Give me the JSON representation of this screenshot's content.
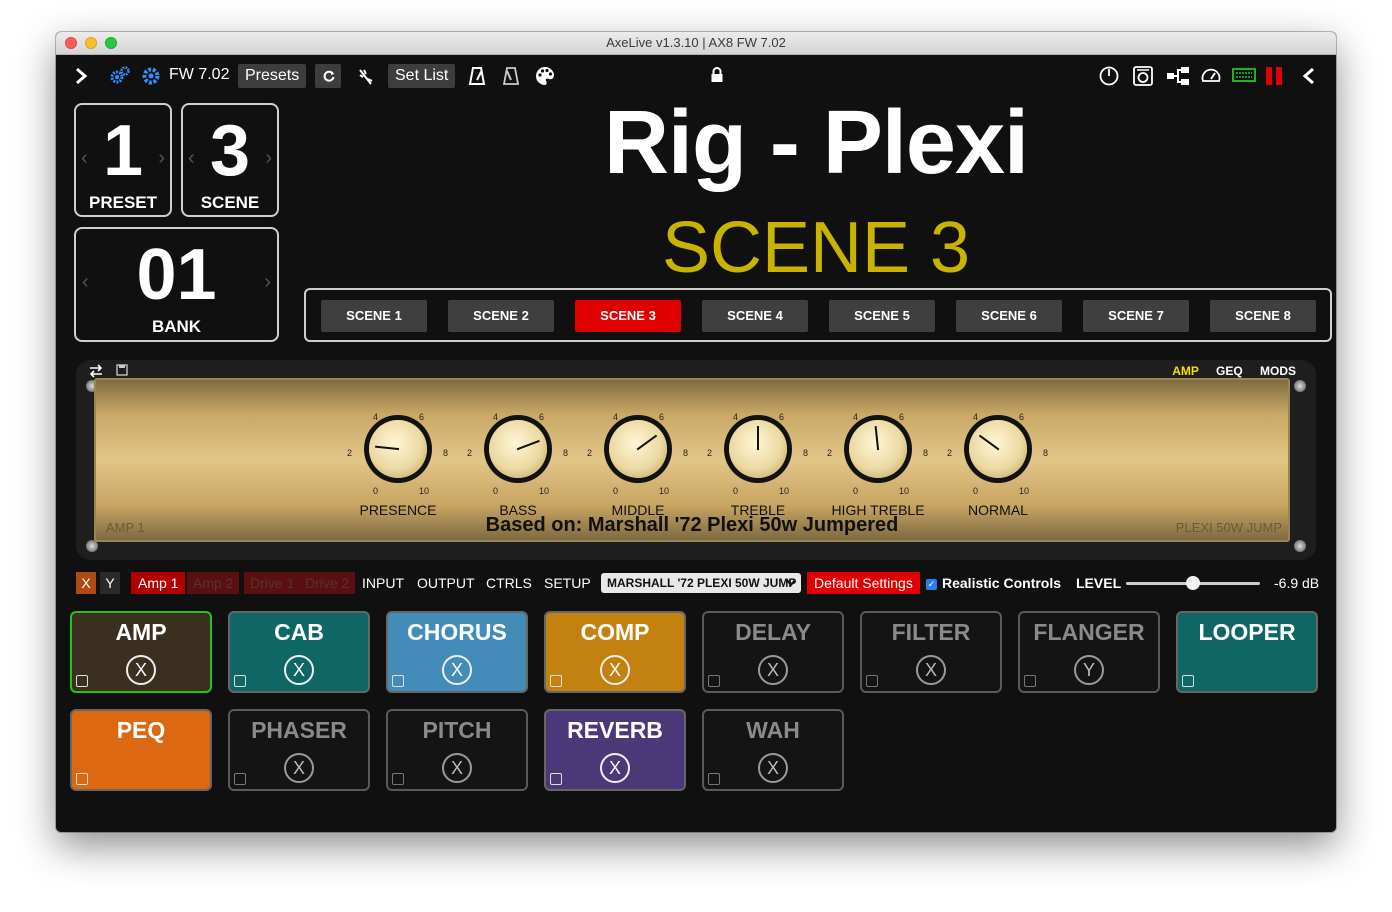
{
  "window": {
    "title": "AxeLive v1.3.10 | AX8 FW 7.02"
  },
  "toolbar": {
    "fw_label": "FW 7.02",
    "presets_label": "Presets",
    "setlist_label": "Set List",
    "icons_left": [
      "chevron-right-icon",
      "gears-icon",
      "gear-icon",
      "refresh-icon",
      "tuner-icon",
      "metronome-icon",
      "metronome-alt-icon",
      "palette-icon",
      "lock-icon"
    ],
    "icons_right": [
      "power-icon",
      "cabinet-icon",
      "routing-icon",
      "gauge-icon",
      "keyboard-icon",
      "pause-icon",
      "chevron-left-icon"
    ],
    "accent_green": "#21c421",
    "accent_red": "#e00000"
  },
  "preset": {
    "value": "1",
    "label": "PRESET"
  },
  "scene_counter": {
    "value": "3",
    "label": "SCENE"
  },
  "bank": {
    "value": "01",
    "label": "BANK"
  },
  "rig": {
    "name": "Rig - Plexi",
    "scene_name": "SCENE 3",
    "scene_color": "#c7b300"
  },
  "scenes": [
    "SCENE 1",
    "SCENE 2",
    "SCENE 3",
    "SCENE 4",
    "SCENE 5",
    "SCENE 6",
    "SCENE 7",
    "SCENE 8"
  ],
  "active_scene_index": 2,
  "amp": {
    "tabs": [
      "AMP",
      "GEQ",
      "MODS"
    ],
    "active_tab": "AMP",
    "left_tag": "AMP 1",
    "right_tag": "PLEXI 50W JUMP",
    "based_on": "Based on: Marshall '72 Plexi 50w Jumpered",
    "tick_labels": [
      "0",
      "2",
      "4",
      "6",
      "8",
      "10"
    ],
    "knobs": [
      {
        "label": "PRESENCE",
        "value": 2.2
      },
      {
        "label": "BASS",
        "value": 7.3
      },
      {
        "label": "MIDDLE",
        "value": 6.8
      },
      {
        "label": "TREBLE",
        "value": 5.0
      },
      {
        "label": "HIGH TREBLE",
        "value": 4.8
      },
      {
        "label": "NORMAL",
        "value": 3.2
      }
    ]
  },
  "controls": {
    "x_label": "X",
    "y_label": "Y",
    "amp1": "Amp 1",
    "amp2": "Amp 2",
    "drive1": "Drive 1",
    "drive2": "Drive 2",
    "tabs": [
      "INPUT",
      "OUTPUT",
      "CTRLS",
      "SETUP"
    ],
    "amp_model": "MARSHALL '72 PLEXI 50W JUMP",
    "default_settings": "Default Settings",
    "realistic_controls": "Realistic Controls",
    "level_label": "LEVEL",
    "level_value": "-6.9 dB",
    "level_fraction": 0.5
  },
  "blocks": [
    {
      "name": "AMP",
      "state": "X",
      "bg": "#3b3020",
      "border": "#21c421",
      "text": "#ffffff"
    },
    {
      "name": "CAB",
      "state": "X",
      "bg": "#0e6665",
      "border": "#666666",
      "text": "#ffffff"
    },
    {
      "name": "CHORUS",
      "state": "X",
      "bg": "#438bb8",
      "border": "#666666",
      "text": "#ffffff"
    },
    {
      "name": "COMP",
      "state": "X",
      "bg": "#c3820f",
      "border": "#666666",
      "text": "#ffffff"
    },
    {
      "name": "DELAY",
      "state": "X",
      "bg": "#141414",
      "border": "#5a5a5a",
      "text": "#8a8a8a"
    },
    {
      "name": "FILTER",
      "state": "X",
      "bg": "#141414",
      "border": "#5a5a5a",
      "text": "#8a8a8a"
    },
    {
      "name": "FLANGER",
      "state": "Y",
      "bg": "#141414",
      "border": "#5a5a5a",
      "text": "#8a8a8a"
    },
    {
      "name": "LOOPER",
      "state": "",
      "bg": "#0e6665",
      "border": "#666666",
      "text": "#ffffff"
    },
    {
      "name": "PEQ",
      "state": "",
      "bg": "#dc6812",
      "border": "#666666",
      "text": "#ffffff"
    },
    {
      "name": "PHASER",
      "state": "X",
      "bg": "#141414",
      "border": "#5a5a5a",
      "text": "#8a8a8a"
    },
    {
      "name": "PITCH",
      "state": "X",
      "bg": "#141414",
      "border": "#5a5a5a",
      "text": "#8a8a8a"
    },
    {
      "name": "REVERB",
      "state": "X",
      "bg": "#4b3878",
      "border": "#666666",
      "text": "#ffffff"
    },
    {
      "name": "WAH",
      "state": "X",
      "bg": "#141414",
      "border": "#5a5a5a",
      "text": "#8a8a8a"
    }
  ]
}
